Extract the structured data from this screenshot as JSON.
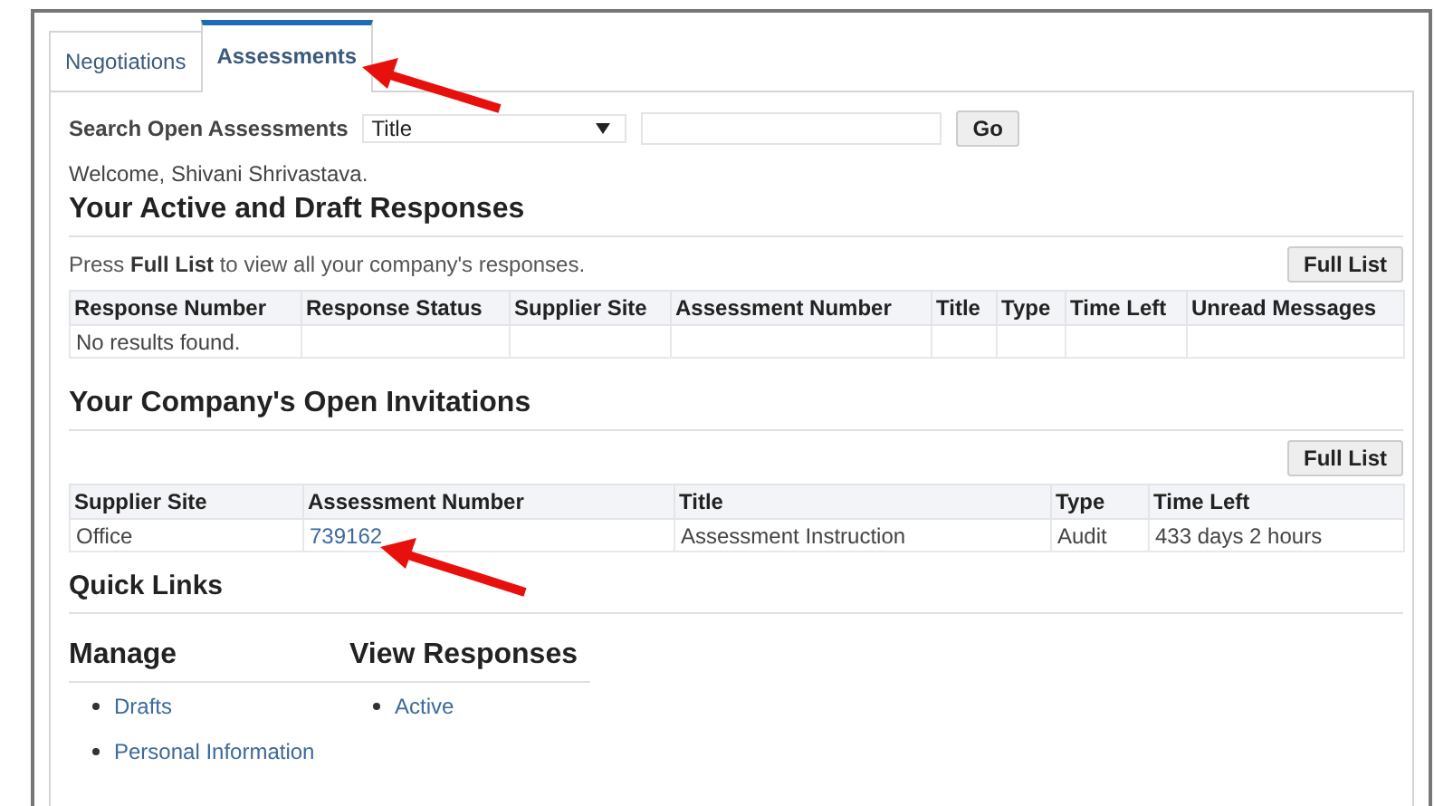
{
  "tabs": [
    {
      "label": "Negotiations",
      "selected": false
    },
    {
      "label": "Assessments",
      "selected": true
    }
  ],
  "search": {
    "label": "Search Open Assessments",
    "select": "Title",
    "button": "Go"
  },
  "welcome": "Welcome, Shivani Shrivastava.",
  "responses": {
    "title": "Your Active and Draft Responses",
    "hint": "Press **Full List** to view all your company's responses.",
    "button": "Full List",
    "columns": [
      "Response Number",
      "Response Status",
      "Supplier Site",
      "Assessment Number",
      "Title",
      "Type",
      "Time Left",
      "Unread Messages"
    ],
    "empty_message": "No results found."
  },
  "invitations": {
    "title": "Your Company's Open Invitations",
    "button": "Full List",
    "columns": [
      "Supplier Site",
      "Assessment Number",
      "Title",
      "Type",
      "Time Left"
    ],
    "rows": [
      {
        "cells": [
          {
            "text": "Office",
            "kind": "text"
          },
          {
            "text": "739162",
            "kind": "link"
          },
          {
            "text": "Assessment Instruction",
            "kind": "text"
          },
          {
            "text": "Audit",
            "kind": "text"
          },
          {
            "text": "433 days 2 hours",
            "kind": "text"
          }
        ]
      }
    ]
  },
  "quick_links": {
    "title": "Quick Links",
    "groups": [
      {
        "title": "Manage",
        "links": [
          "Drafts",
          "Personal Information"
        ]
      },
      {
        "title": "View Responses",
        "links": [
          "Active"
        ]
      }
    ]
  }
}
